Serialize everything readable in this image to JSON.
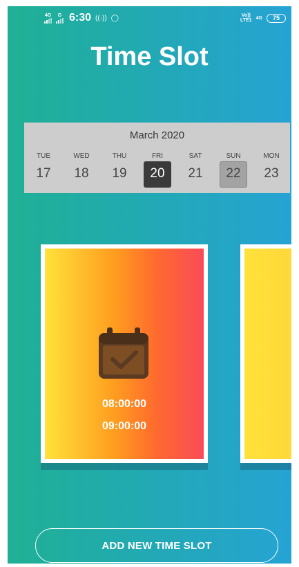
{
  "status_bar": {
    "net1_label": "4G",
    "net2_label": "G",
    "time": "6:30",
    "hotspot_glyph": "((·))",
    "whatsapp_glyph": "◯",
    "volte_label": "Vo))\nLTE1",
    "net3_label": "4G",
    "battery": "75"
  },
  "title": "Time Slot",
  "calendar": {
    "month": "March 2020",
    "days": [
      {
        "name": "TUE",
        "num": "17"
      },
      {
        "name": "WED",
        "num": "18"
      },
      {
        "name": "THU",
        "num": "19"
      },
      {
        "name": "FRI",
        "num": "20"
      },
      {
        "name": "SAT",
        "num": "21"
      },
      {
        "name": "SUN",
        "num": "22"
      },
      {
        "name": "MON",
        "num": "23"
      }
    ],
    "selected_day": "20",
    "today_day": "22"
  },
  "slots": [
    {
      "start": "08:00:00",
      "end": "09:00:00"
    }
  ],
  "add_button_label": "ADD NEW TIME SLOT",
  "colors": {
    "gradient_left": "#1fb094",
    "gradient_right": "#26a3d4",
    "card_yellow": "#ffe23a",
    "card_red": "#f94b58",
    "selected_day_bg": "#3a3a3a",
    "today_day_bg": "#a3a3a3"
  }
}
